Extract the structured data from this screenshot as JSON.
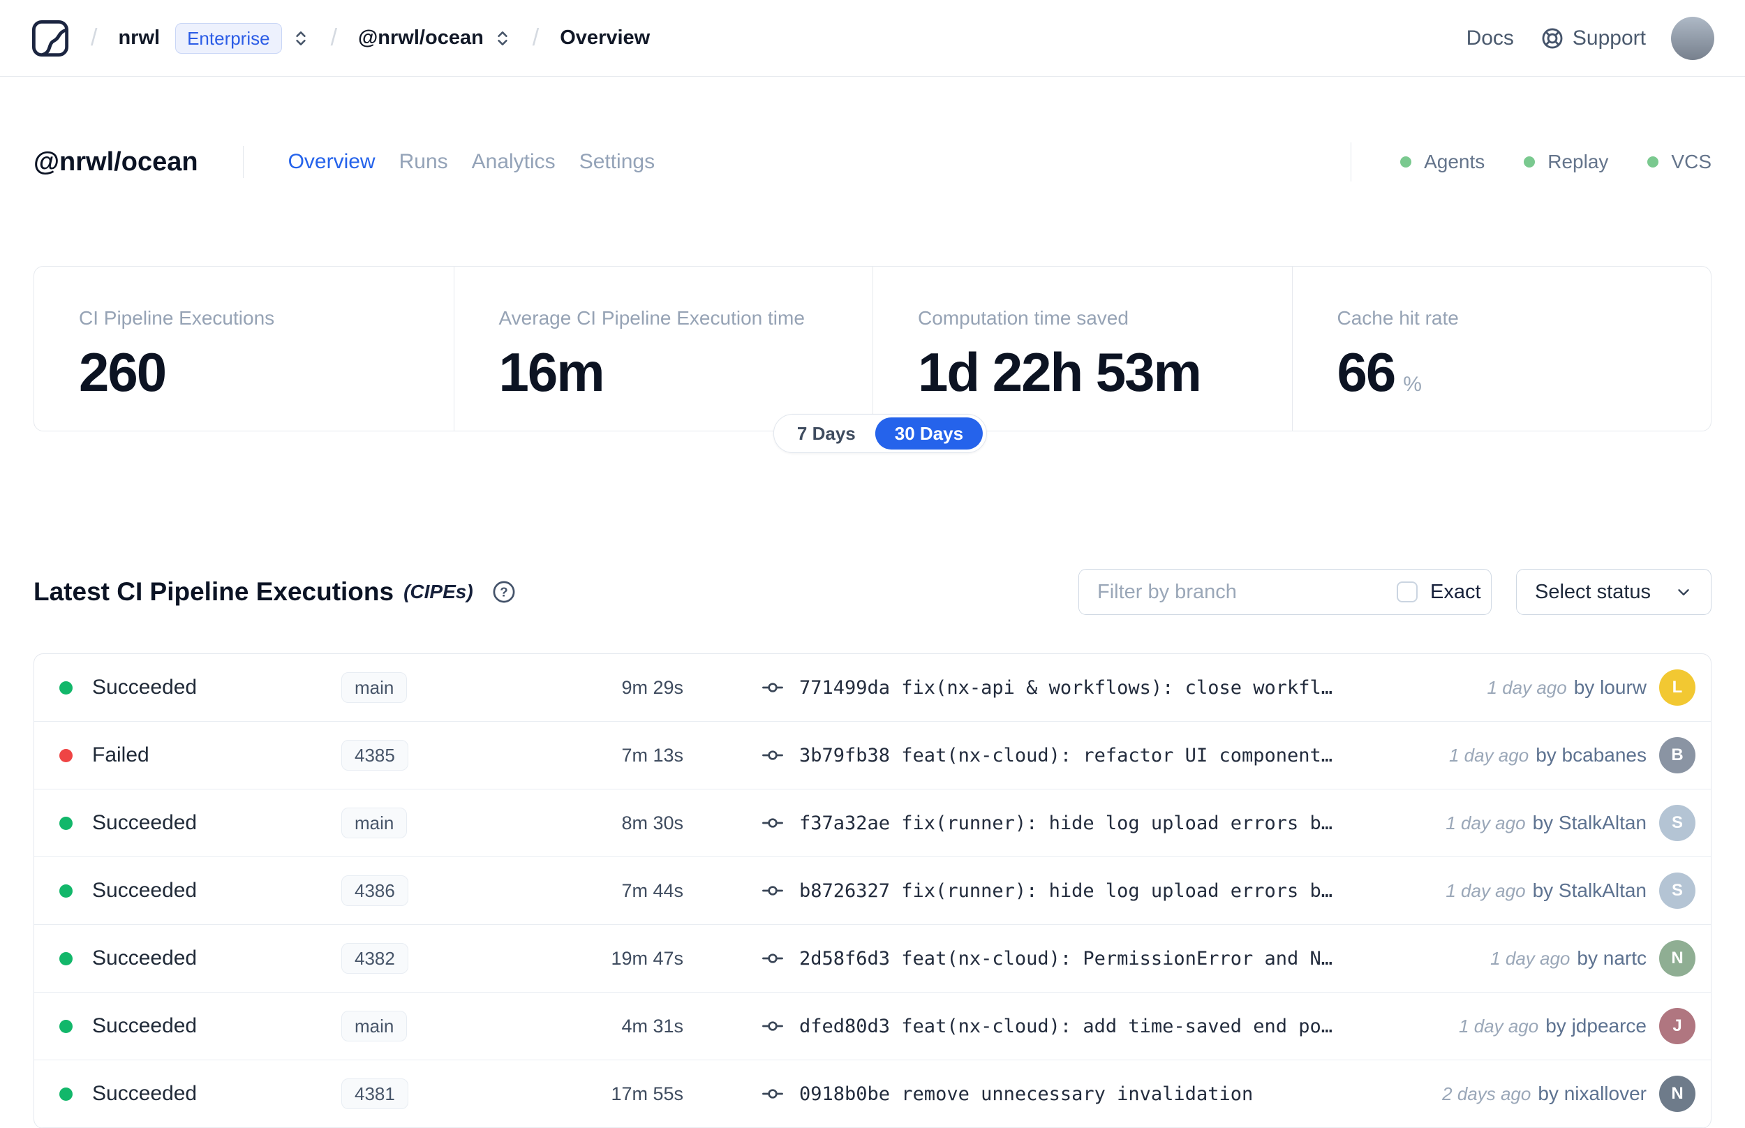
{
  "colors": {
    "accent": "#2563eb",
    "success": "#12b76a",
    "failed": "#ef4444",
    "chip_dot": "#7ac98f"
  },
  "nav": {
    "breadcrumb": {
      "org": "nrwl",
      "badge": "Enterprise",
      "workspace": "@nrwl/ocean",
      "page": "Overview"
    },
    "links": {
      "docs": "Docs",
      "support": "Support"
    }
  },
  "workspace_header": {
    "title": "@nrwl/ocean",
    "tabs": [
      {
        "label": "Overview",
        "active": true
      },
      {
        "label": "Runs",
        "active": false
      },
      {
        "label": "Analytics",
        "active": false
      },
      {
        "label": "Settings",
        "active": false
      }
    ],
    "status_chips": [
      "Agents",
      "Replay",
      "VCS"
    ]
  },
  "stats": {
    "cards": [
      {
        "label": "CI Pipeline Executions",
        "value": "260",
        "suffix": ""
      },
      {
        "label": "Average CI Pipeline Execution time",
        "value": "16m",
        "suffix": ""
      },
      {
        "label": "Computation time saved",
        "value": "1d 22h 53m",
        "suffix": ""
      },
      {
        "label": "Cache hit rate",
        "value": "66",
        "suffix": "%"
      }
    ],
    "range_toggle": {
      "options": [
        "7 Days",
        "30 Days"
      ],
      "selected": "30 Days"
    }
  },
  "cipe_section": {
    "title": "Latest CI Pipeline Executions",
    "title_suffix": "(CIPEs)",
    "filter_placeholder": "Filter by branch",
    "exact_label": "Exact",
    "status_dropdown_label": "Select status",
    "rows": [
      {
        "status": "Succeeded",
        "outcome": "success",
        "branch": "main",
        "duration": "9m 29s",
        "commit_hash": "771499da",
        "commit_message": "fix(nx-api & workflows): close workfl…",
        "time_ago": "1 day ago",
        "author": "by lourw",
        "avatar_initial": "L",
        "avatar_color": "#f2c832"
      },
      {
        "status": "Failed",
        "outcome": "failed",
        "branch": "4385",
        "duration": "7m 13s",
        "commit_hash": "3b79fb38",
        "commit_message": "feat(nx-cloud): refactor UI component…",
        "time_ago": "1 day ago",
        "author": "by bcabanes",
        "avatar_initial": "B",
        "avatar_color": "#8a94a3"
      },
      {
        "status": "Succeeded",
        "outcome": "success",
        "branch": "main",
        "duration": "8m 30s",
        "commit_hash": "f37a32ae",
        "commit_message": "fix(runner): hide log upload errors b…",
        "time_ago": "1 day ago",
        "author": "by StalkAltan",
        "avatar_initial": "S",
        "avatar_color": "#b4c4d4"
      },
      {
        "status": "Succeeded",
        "outcome": "success",
        "branch": "4386",
        "duration": "7m 44s",
        "commit_hash": "b8726327",
        "commit_message": "fix(runner): hide log upload errors b…",
        "time_ago": "1 day ago",
        "author": "by StalkAltan",
        "avatar_initial": "S",
        "avatar_color": "#b4c4d4"
      },
      {
        "status": "Succeeded",
        "outcome": "success",
        "branch": "4382",
        "duration": "19m 47s",
        "commit_hash": "2d58f6d3",
        "commit_message": "feat(nx-cloud): PermissionError and N…",
        "time_ago": "1 day ago",
        "author": "by nartc",
        "avatar_initial": "N",
        "avatar_color": "#8fae93"
      },
      {
        "status": "Succeeded",
        "outcome": "success",
        "branch": "main",
        "duration": "4m 31s",
        "commit_hash": "dfed80d3",
        "commit_message": "feat(nx-cloud): add time-saved end po…",
        "time_ago": "1 day ago",
        "author": "by jdpearce",
        "avatar_initial": "J",
        "avatar_color": "#b07680"
      },
      {
        "status": "Succeeded",
        "outcome": "success",
        "branch": "4381",
        "duration": "17m 55s",
        "commit_hash": "0918b0be",
        "commit_message": "remove unnecessary invalidation",
        "time_ago": "2 days ago",
        "author": "by nixallover",
        "avatar_initial": "N",
        "avatar_color": "#6e7b8a"
      }
    ]
  }
}
